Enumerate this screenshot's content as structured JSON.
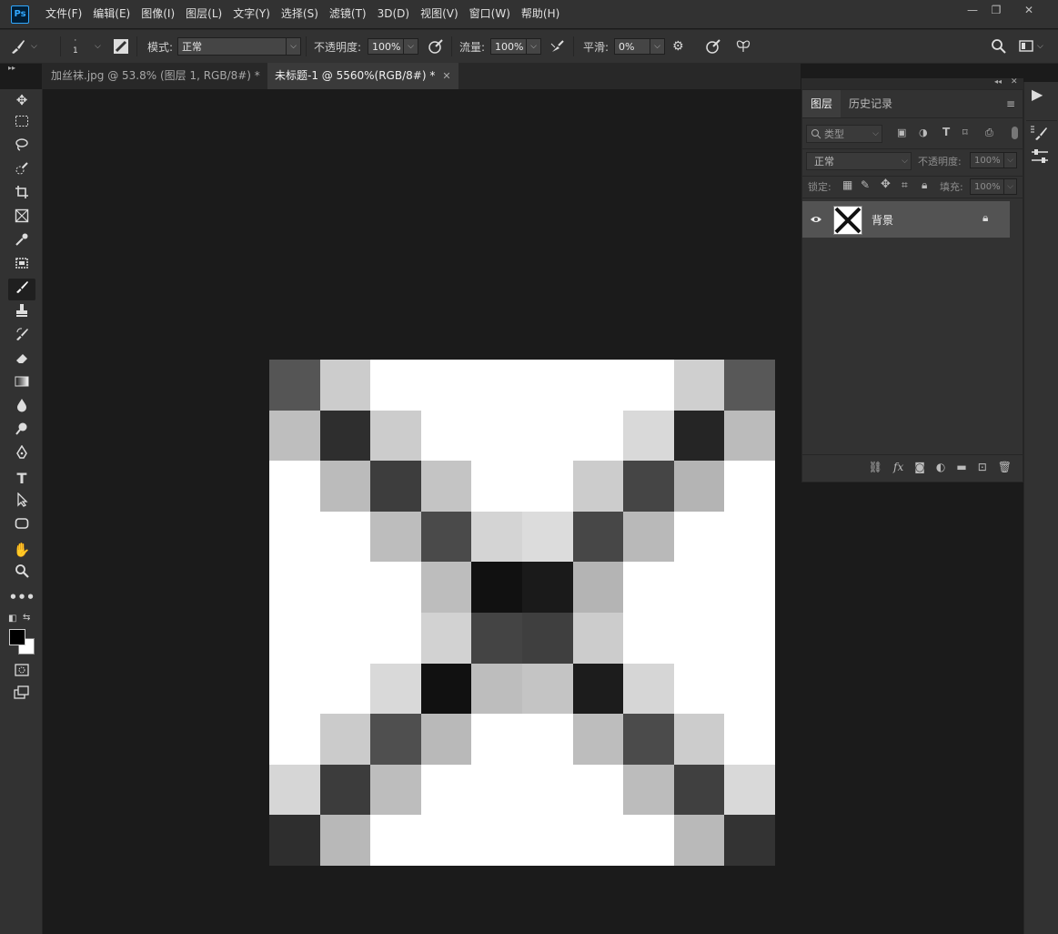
{
  "app": {
    "logo": "Ps",
    "menu": [
      "文件(F)",
      "编辑(E)",
      "图像(I)",
      "图层(L)",
      "文字(Y)",
      "选择(S)",
      "滤镜(T)",
      "3D(D)",
      "视图(V)",
      "窗口(W)",
      "帮助(H)"
    ],
    "window_buttons": [
      "—",
      "❐",
      "✕"
    ]
  },
  "options": {
    "brush_size": "1",
    "mode_label": "模式:",
    "mode_value": "正常",
    "opacity_label": "不透明度:",
    "opacity_value": "100%",
    "flow_label": "流量:",
    "flow_value": "100%",
    "smooth_label": "平滑:",
    "smooth_value": "0%"
  },
  "tabs": [
    {
      "label": "加丝袜.jpg @ 53.8% (图层 1, RGB/8#) *",
      "active": false
    },
    {
      "label": "未标题-1 @ 5560%(RGB/8#) *",
      "active": true
    }
  ],
  "tools": [
    "move-icon",
    "marquee-icon",
    "lasso-icon",
    "quick-select-icon",
    "crop-icon",
    "frame-icon",
    "eyedropper-icon",
    "patch-icon",
    "brush-icon",
    "stamp-icon",
    "history-brush-icon",
    "eraser-icon",
    "gradient-icon",
    "blur-icon",
    "dodge-icon",
    "pen-icon",
    "type-icon",
    "path-select-icon",
    "shape-icon",
    "hand-icon",
    "zoom-icon",
    "more-icon"
  ],
  "colors": {
    "foreground": "#000000",
    "background": "#ffffff",
    "canvas_bg": "#1b1b1b",
    "panel": "#323232"
  },
  "canvas": {
    "grid_size": 10,
    "pixels": [
      [
        "#555555",
        "#cccccc",
        "#ffffff",
        "#ffffff",
        "#ffffff",
        "#ffffff",
        "#ffffff",
        "#ffffff",
        "#cfcfcf",
        "#585858"
      ],
      [
        "#bebebe",
        "#2e2e2e",
        "#cccccc",
        "#ffffff",
        "#ffffff",
        "#ffffff",
        "#ffffff",
        "#d9d9d9",
        "#252525",
        "#bbbbbb"
      ],
      [
        "#ffffff",
        "#bbbbbb",
        "#3d3d3d",
        "#c4c4c4",
        "#ffffff",
        "#ffffff",
        "#cccccc",
        "#454545",
        "#b4b4b4",
        "#ffffff"
      ],
      [
        "#ffffff",
        "#ffffff",
        "#bdbdbd",
        "#4a4a4a",
        "#d4d4d4",
        "#dcdcdc",
        "#474747",
        "#b9b9b9",
        "#ffffff",
        "#ffffff"
      ],
      [
        "#ffffff",
        "#ffffff",
        "#ffffff",
        "#bdbdbd",
        "#111111",
        "#1a1a1a",
        "#b4b4b4",
        "#ffffff",
        "#ffffff",
        "#ffffff"
      ],
      [
        "#ffffff",
        "#ffffff",
        "#ffffff",
        "#d2d2d2",
        "#444444",
        "#3f3f3f",
        "#cccccc",
        "#ffffff",
        "#ffffff",
        "#ffffff"
      ],
      [
        "#ffffff",
        "#ffffff",
        "#d9d9d9",
        "#111111",
        "#bdbdbd",
        "#c4c4c4",
        "#1c1c1c",
        "#d6d6d6",
        "#ffffff",
        "#ffffff"
      ],
      [
        "#ffffff",
        "#cbcbcb",
        "#4f4f4f",
        "#b9b9b9",
        "#ffffff",
        "#ffffff",
        "#bdbdbd",
        "#4b4b4b",
        "#cccccc",
        "#ffffff"
      ],
      [
        "#d6d6d6",
        "#3c3c3c",
        "#bdbdbd",
        "#ffffff",
        "#ffffff",
        "#ffffff",
        "#ffffff",
        "#bcbcbc",
        "#404040",
        "#d9d9d9"
      ],
      [
        "#2e2e2e",
        "#b8b8b8",
        "#ffffff",
        "#ffffff",
        "#ffffff",
        "#ffffff",
        "#ffffff",
        "#ffffff",
        "#b9b9b9",
        "#333333"
      ]
    ]
  },
  "layers_panel": {
    "tabs": [
      "图层",
      "历史记录"
    ],
    "filter_placeholder": "类型",
    "blend_mode": "正常",
    "opacity_label": "不透明度:",
    "opacity_value": "100%",
    "lock_label": "锁定:",
    "fill_label": "填充:",
    "fill_value": "100%",
    "layers": [
      {
        "name": "背景",
        "visible": true,
        "locked": true
      }
    ]
  }
}
